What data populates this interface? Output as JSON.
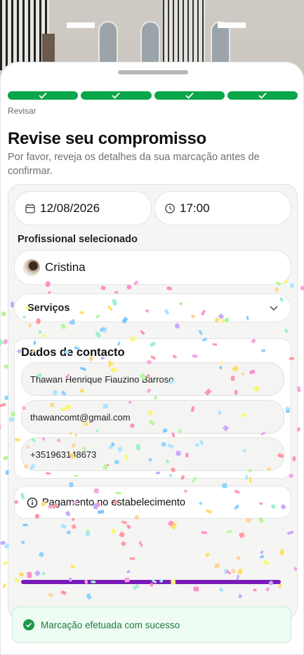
{
  "progress": {
    "steps_total": 4,
    "steps_completed": 4,
    "current_step_label": "Revisar"
  },
  "header": {
    "title": "Revise seu compromisso",
    "subtitle": "Por favor, reveja os detalhes da sua marcação antes de confirmar."
  },
  "appointment": {
    "date": "12/08/2026",
    "time": "17:00"
  },
  "professional": {
    "section_label": "Profissional selecionado",
    "name": "Cristina"
  },
  "services": {
    "label": "Serviços"
  },
  "contact": {
    "section_title": "Dados de contacto",
    "name": "Thawan Henrique Fiauzino Barroso",
    "email": "thawancomt@gmail.com",
    "phone": "+351963148673"
  },
  "payment": {
    "method": "Pagamento no estabelecimento"
  },
  "toast": {
    "message": "Marcação efetuada com sucesso"
  },
  "colors": {
    "progress_green": "#0aa64a",
    "toast_text": "#1a7a3e",
    "primary": "#7a1ab8"
  },
  "icons": {
    "date": "calendar-icon",
    "time": "clock-icon",
    "services": "chevron-down-icon",
    "payment": "info-icon",
    "toast": "check-circle-icon"
  }
}
